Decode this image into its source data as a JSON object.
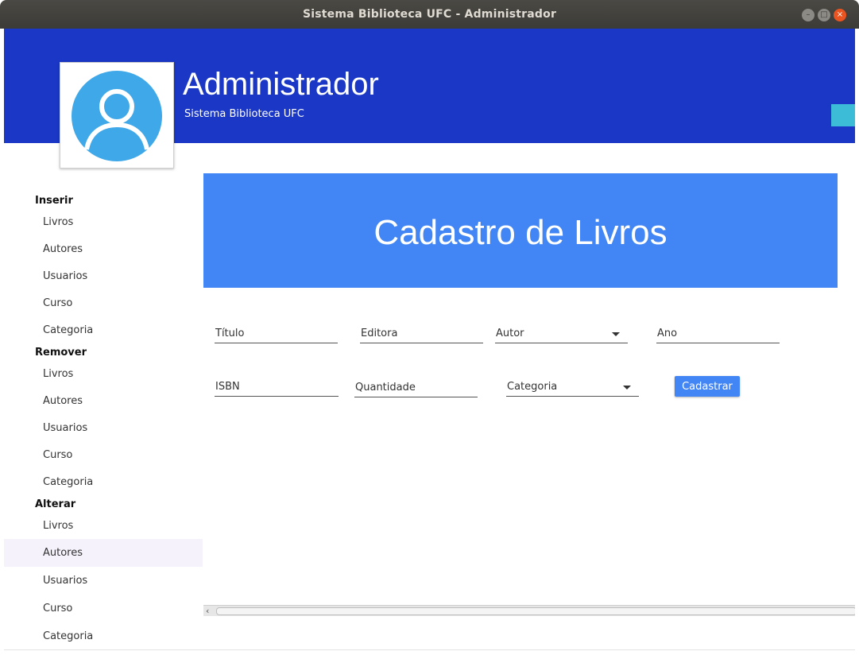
{
  "window": {
    "title": "Sistema Biblioteca UFC - Administrador",
    "controls": [
      "minimize-icon",
      "maximize-icon",
      "close-icon"
    ]
  },
  "header": {
    "title": "Administrador",
    "subtitle": "Sistema Biblioteca UFC",
    "avatar_icon": "user-avatar-icon",
    "colors": {
      "header_bg": "#1a37c6",
      "avatar": "#3fa8e8",
      "side_tab": "#3dbcd8"
    }
  },
  "sidebar": {
    "sections": [
      {
        "label": "Inserir",
        "items": [
          "Livros",
          "Autores",
          "Usuarios",
          "Curso",
          "Categoria"
        ]
      },
      {
        "label": "Remover",
        "items": [
          "Livros",
          "Autores",
          "Usuarios",
          "Curso",
          "Categoria"
        ]
      },
      {
        "label": "Alterar",
        "items": [
          "Livros",
          "Autores",
          "Usuarios",
          "Curso",
          "Categoria"
        ]
      }
    ],
    "selected": "Alterar > Autores"
  },
  "main": {
    "banner_title": "Cadastro de Livros",
    "banner_color": "#4285f4",
    "fields": {
      "titulo": "Título",
      "editora": "Editora",
      "autor": "Autor",
      "ano": "Ano",
      "isbn": "ISBN",
      "quantidade": "Quantidade",
      "categoria": "Categoria"
    },
    "submit_label": "Cadastrar"
  }
}
